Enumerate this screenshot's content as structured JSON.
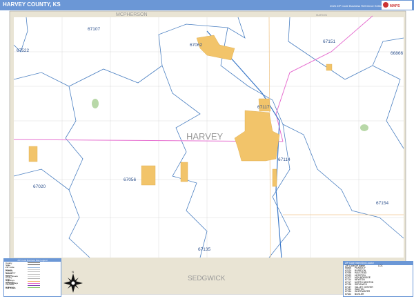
{
  "header": {
    "title": "HARVEY COUNTY, KS",
    "edition": "2026 ZIP Code Business Reference Edition",
    "logo_text": "Market MAPS"
  },
  "map": {
    "county_label": "HARVEY",
    "neighbor_counties": [
      "MCPHERSON",
      "MARION",
      "SEDGWICK"
    ],
    "zip_labels": [
      "67107",
      "67062",
      "67151",
      "66866",
      "67522",
      "67117",
      "67114",
      "67020",
      "67056",
      "67154",
      "67135"
    ],
    "colors": {
      "header": "#6b97d6",
      "city": "#f2c46a",
      "zip_boundary": "#4a7fc1",
      "highway": "#e66fd0",
      "neighbor": "#e9e4d4"
    }
  },
  "zip_legend": {
    "title": "ZIP Code Index/Grid Locator",
    "columns": [
      "ZIP Code",
      "ZIP Name",
      "LOC"
    ],
    "rows": [
      [
        "66866",
        "PEABODY",
        ""
      ],
      [
        "67020",
        "BURRTON",
        ""
      ],
      [
        "67056",
        "HALSTEAD",
        ""
      ],
      [
        "67062",
        "HESSTON",
        ""
      ],
      [
        "67107",
        "MOUNDRIDGE",
        ""
      ],
      [
        "67114",
        "NEWTON",
        ""
      ],
      [
        "67117",
        "NORTH NEWTON",
        ""
      ],
      [
        "67135",
        "SEDGWICK",
        ""
      ],
      [
        "67147",
        "VALLEY CENTER",
        ""
      ],
      [
        "67151",
        "WALTON",
        ""
      ],
      [
        "67154",
        "WHITEWATER",
        ""
      ],
      [
        "67522",
        "BUHLER",
        ""
      ]
    ]
  },
  "map_legend": {
    "title": "ZIP Code Business Map Legend",
    "items": [
      "County",
      "State",
      "ZIP Code",
      "Streets",
      "Primary Streets",
      "Secondary Streets",
      "Minor Streets",
      "County Highways",
      "State Highways",
      "US Highways",
      "Interstate Highways",
      "Rail Roads"
    ],
    "swatches": [
      "#555",
      "#333",
      "#9bbbe0",
      "#ccc",
      "#bbb",
      "#ccc",
      "#ddd",
      "#aaa",
      "#f0b870",
      "#e66fd0",
      "#7a3fb0",
      "#7ec860"
    ]
  },
  "compass": {
    "label": "N"
  }
}
